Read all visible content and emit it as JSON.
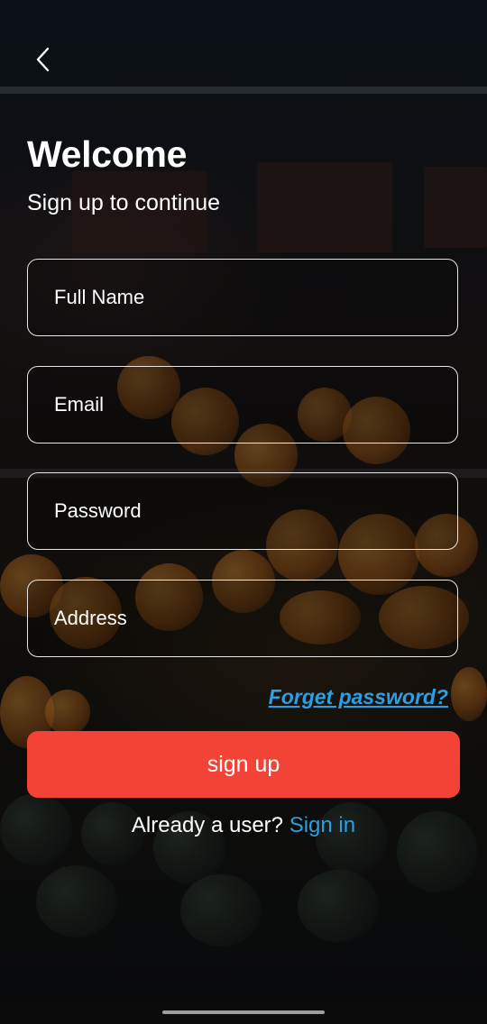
{
  "header": {
    "back_icon": "chevron-left-icon",
    "title": "Welcome",
    "subtitle": "Sign up to continue"
  },
  "form": {
    "full_name_placeholder": "Full Name",
    "email_placeholder": "Email",
    "password_placeholder": "Password",
    "address_placeholder": "Address",
    "forgot_password_label": "Forget password?",
    "submit_label": "sign up"
  },
  "footer": {
    "already_text": "Already a user?",
    "signin_label": "Sign in"
  },
  "colors": {
    "accent": "#f24336",
    "link": "#2b9fe4",
    "text": "#ffffff"
  }
}
